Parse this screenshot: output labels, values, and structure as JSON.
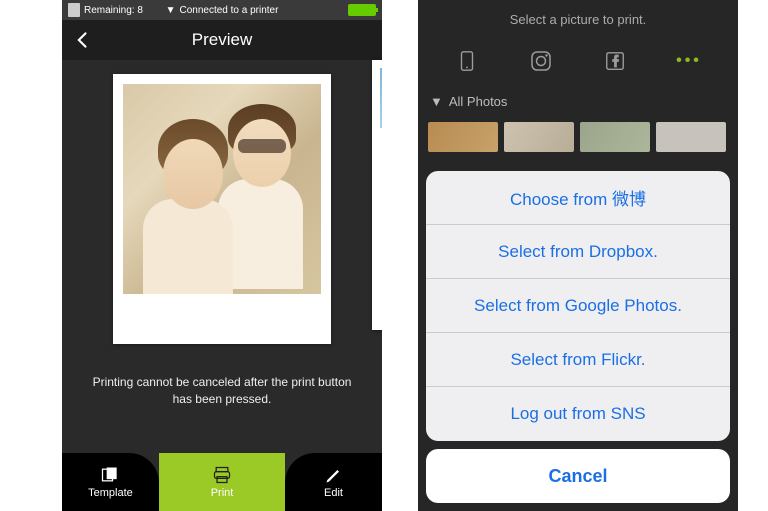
{
  "left": {
    "status": {
      "remaining": "Remaining: 8",
      "connected": "Connected to a printer"
    },
    "nav": {
      "title": "Preview"
    },
    "warning": "Printing cannot be canceled after the print button has been pressed.",
    "toolbar": {
      "template": "Template",
      "print": "Print",
      "edit": "Edit"
    }
  },
  "right": {
    "header": "Select a picture to print.",
    "filter": "All Photos",
    "sheet": {
      "items": [
        "Choose from 微博",
        "Select from Dropbox.",
        "Select from Google Photos.",
        "Select from Flickr.",
        "Log out from SNS"
      ],
      "cancel": "Cancel"
    }
  }
}
